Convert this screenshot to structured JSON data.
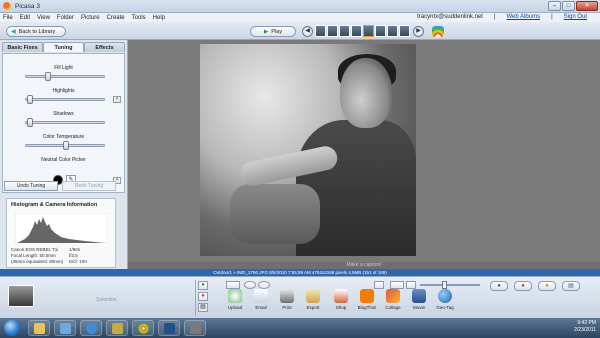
{
  "window": {
    "title": "Picasa 3"
  },
  "menu": {
    "items": [
      "File",
      "Edit",
      "View",
      "Folder",
      "Picture",
      "Create",
      "Tools",
      "Help"
    ],
    "account": "tracyntx@suddenlink.net",
    "web_albums": "Web Albums",
    "sign_out": "Sign Out"
  },
  "toolbar": {
    "back_label": "Back to Library",
    "play_label": "Play"
  },
  "tabs": [
    "Basic Fixes",
    "Tuning",
    "Effects"
  ],
  "tuning": {
    "fill_light": "Fill Light",
    "highlights": "Highlights",
    "shadows": "Shadows",
    "color_temperature": "Color Temperature",
    "neutral_color_picker": "Neutral Color Picker",
    "undo": "Undo Tuning",
    "redo": "Redo Tuning",
    "levels": {
      "fill_light": 0.25,
      "highlights": 0.02,
      "shadows": 0.02,
      "color_temperature": 0.5
    }
  },
  "histogram": {
    "title": "Histogram & Camera Information",
    "camera": [
      {
        "k": "Canon EOS REBEL T1i",
        "v": "1/80s"
      },
      {
        "k": "Focal Length: 50.0mm",
        "v": "f/3.5"
      },
      {
        "k": "(35mm equivalent: 80mm)",
        "v": "ISO: 100"
      }
    ]
  },
  "caption": {
    "placeholder": "Make a caption!"
  },
  "status": {
    "text": "Outdoor1 » IMG_2750.JPG     8/5/2010 7:55:59 AM     4752x3168 pixels     4.5MB     (151 of 189)"
  },
  "tray": {
    "selection_label": "Selection",
    "actions": [
      "Upload",
      "Email",
      "Print",
      "Export",
      "Shop",
      "BlogThis!",
      "Collage",
      "Movie",
      "Geo-Tag"
    ]
  },
  "taskbar": {
    "time": "9:42 PM",
    "date": "2/23/2011"
  },
  "colors": {
    "status_bar": "#2c68b0",
    "panel": "#f2f5f9",
    "canvas": "#7a7a7a"
  }
}
